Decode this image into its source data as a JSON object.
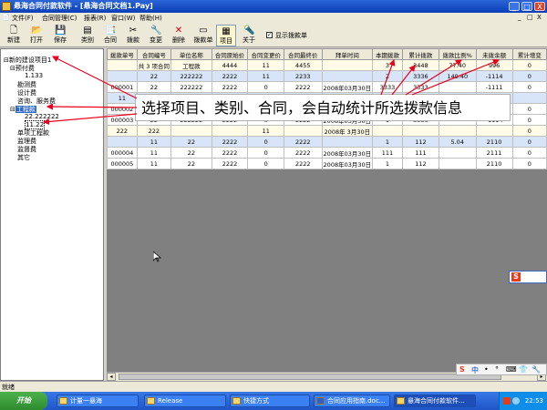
{
  "window": {
    "title": "悬海合同付款软件 - [悬海合同文档1.Pay]",
    "buttons": [
      "_",
      "□",
      "X"
    ],
    "mdi_buttons": [
      "_",
      "□",
      "X"
    ]
  },
  "menu": [
    "文件(F)",
    "合同管理(C)",
    "报表(R)",
    "窗口(W)",
    "帮助(H)"
  ],
  "toolbar": [
    {
      "label": "新建",
      "icon": "new-file-icon",
      "glyph": "🗋"
    },
    {
      "label": "打开",
      "icon": "open-folder-icon",
      "glyph": "📂"
    },
    {
      "label": "保存",
      "icon": "save-disk-icon",
      "glyph": "💾"
    },
    {
      "label": "类别",
      "icon": "category-icon",
      "glyph": "▤"
    },
    {
      "label": "合同",
      "icon": "contract-icon",
      "glyph": "📑"
    },
    {
      "label": "拨款",
      "icon": "payment-icon",
      "glyph": "✂"
    },
    {
      "label": "变更",
      "icon": "change-icon",
      "glyph": "🔧"
    },
    {
      "label": "删除",
      "icon": "delete-icon",
      "glyph": "✕"
    },
    {
      "label": "拨款单",
      "icon": "payment-slip-icon",
      "glyph": "▭"
    },
    {
      "label": "项目",
      "icon": "project-icon",
      "glyph": "▦"
    },
    {
      "label": "关于",
      "icon": "about-icon",
      "glyph": "🔦"
    }
  ],
  "show_slip": {
    "label": "显示拨款单",
    "checked": true
  },
  "tree": [
    {
      "label": "新的建设项目1",
      "level": 0,
      "prefix": "⊟"
    },
    {
      "label": "预付费",
      "level": 1,
      "prefix": "⊟"
    },
    {
      "label": "1.133",
      "level": 2,
      "prefix": ""
    },
    {
      "label": "勘测费",
      "level": 1,
      "prefix": ""
    },
    {
      "label": "设计费",
      "level": 1,
      "prefix": ""
    },
    {
      "label": "咨询、服务费",
      "level": 1,
      "prefix": ""
    },
    {
      "label": "工程款",
      "level": 1,
      "prefix": "⊟",
      "selected": true
    },
    {
      "label": "22.222222",
      "level": 2,
      "prefix": ""
    },
    {
      "label": "11.22",
      "level": 2,
      "prefix": ""
    },
    {
      "label": "单项工程款",
      "level": 1,
      "prefix": ""
    },
    {
      "label": "监理费",
      "level": 1,
      "prefix": ""
    },
    {
      "label": "监督费",
      "level": 1,
      "prefix": ""
    },
    {
      "label": "其它",
      "level": 1,
      "prefix": ""
    }
  ],
  "grid": {
    "headers": [
      "拨款单号",
      "合同编号",
      "单位名称",
      "合同原始价",
      "合同变更价",
      "合同最终价",
      "拜单时间",
      "本期拨款",
      "累计拨款",
      "拨款比例%",
      "未拨余额",
      "累计增变"
    ],
    "rows": [
      {
        "style": "yellow",
        "cells": [
          "",
          "共 3 项合同",
          "工程款",
          "4444",
          "11",
          "4455",
          "",
          "3",
          "3448",
          "77.40",
          "996",
          "0"
        ]
      },
      {
        "style": "blue",
        "cells": [
          "",
          "22",
          "222222",
          "2222",
          "11",
          "2233",
          "",
          "2",
          "3336",
          "149.40",
          "-1114",
          "0"
        ]
      },
      {
        "style": "white",
        "cells": [
          "000001",
          "22",
          "222222",
          "2222",
          "0",
          "2222",
          "2008年03月30日",
          "3333",
          "3333",
          "",
          "-1111",
          "0"
        ]
      },
      {
        "style": "blue",
        "cells": [
          "11",
          "",
          "",
          "",
          "",
          "",
          "",
          "",
          "",
          "",
          "",
          ""
        ]
      },
      {
        "style": "white",
        "cells": [
          "000002",
          "",
          "",
          "",
          "",
          "",
          "",
          "",
          "",
          "",
          "-1112",
          "0"
        ]
      },
      {
        "style": "white",
        "cells": [
          "000003",
          "22",
          "222222",
          "2222",
          "0",
          "2222",
          "2008年03月30日",
          "1",
          "3336",
          "",
          "-1114",
          "0"
        ]
      },
      {
        "style": "yellow",
        "cells": [
          "222",
          "222",
          "",
          "",
          "11",
          "",
          "2008年 3月30日",
          "",
          "",
          "",
          "",
          "0"
        ]
      },
      {
        "style": "blue",
        "cells": [
          "",
          "11",
          "22",
          "2222",
          "0",
          "2222",
          "",
          "1",
          "112",
          "5.04",
          "2110",
          "0"
        ]
      },
      {
        "style": "white",
        "cells": [
          "000004",
          "11",
          "22",
          "2222",
          "0",
          "2222",
          "2008年03月30日",
          "111",
          "111",
          "",
          "2111",
          "0"
        ]
      },
      {
        "style": "white",
        "cells": [
          "000005",
          "11",
          "22",
          "2222",
          "0",
          "2222",
          "2008年03月30日",
          "1",
          "112",
          "",
          "2110",
          "0"
        ]
      }
    ]
  },
  "annotation": "选择项目、类别、合同，会自动统计所选拨款信息",
  "status": "就绪",
  "taskbar": {
    "start": "开始",
    "items": [
      "计量一悬海",
      "Release",
      "快捷方式",
      "合同应用指南.doc...",
      "悬海合同付款软件..."
    ],
    "active_index": 4,
    "clock": "22:53"
  },
  "ime_small": "S",
  "ime_bar": [
    "S",
    "中",
    "•",
    "°",
    "⌨",
    "👕",
    "🔧"
  ],
  "colors": {
    "title_bar": "#0a3fb8",
    "selection": "#316ac5",
    "annotation_arrow": "#e8001c",
    "row_blue": "#d8e4f8",
    "row_yellow": "#fffbe6"
  }
}
